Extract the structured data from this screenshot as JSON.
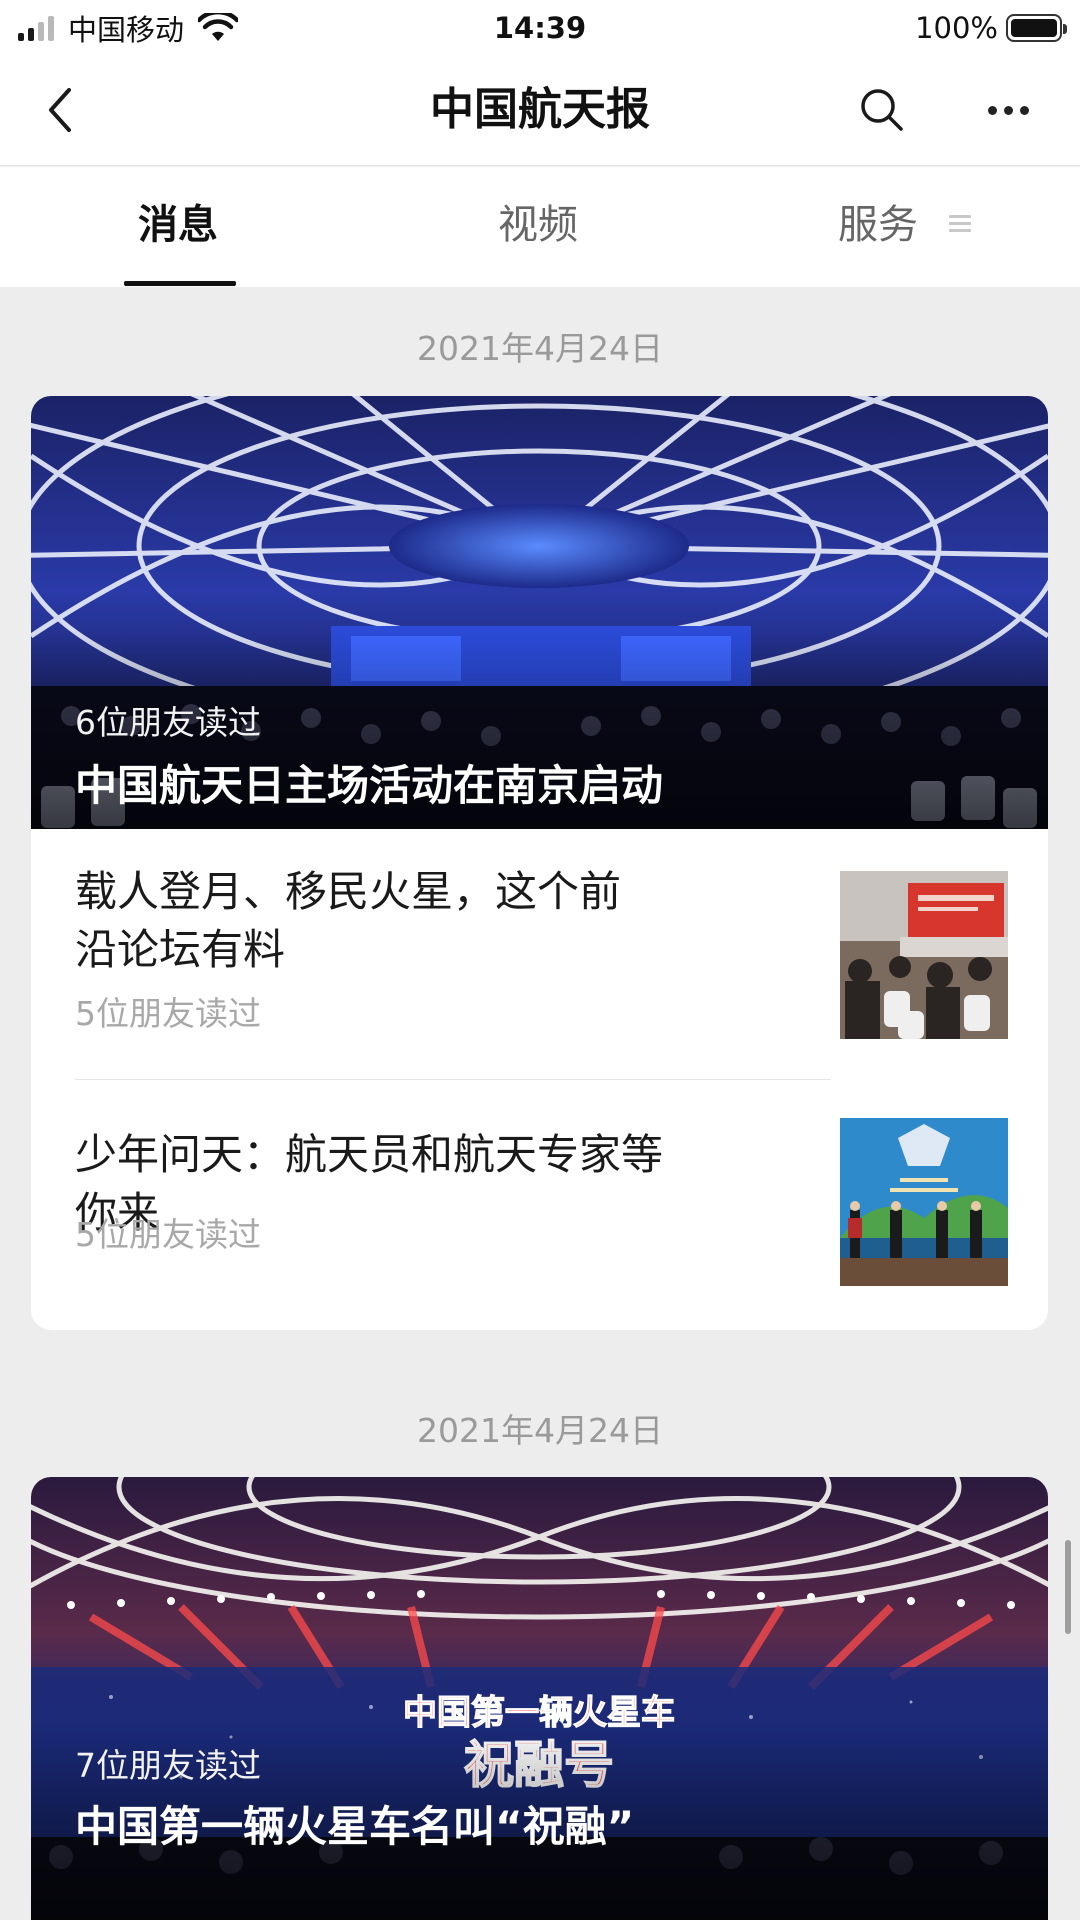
{
  "status_bar": {
    "carrier": "中国移动",
    "time": "14:39",
    "battery_text": "100%",
    "battery_level": 1.0,
    "signal_bars": 2
  },
  "nav": {
    "title": "中国航天报",
    "back_icon": "chevron-left-icon",
    "search_icon": "search-icon",
    "more_icon": "more-dots-icon"
  },
  "tabs": [
    {
      "label": "消息",
      "active": true
    },
    {
      "label": "视频",
      "active": false
    },
    {
      "label": "服务",
      "active": false
    }
  ],
  "feed": [
    {
      "date": "2021年4月24日",
      "cover": {
        "readers": "6位朋友读过",
        "title": "中国航天日主场活动在南京启动"
      },
      "articles": [
        {
          "title": "载人登月、移民火星，这个前沿论坛有料",
          "readers": "5位朋友读过"
        },
        {
          "title": "少年问天：航天员和航天专家等你来",
          "readers": "5位朋友读过"
        }
      ]
    },
    {
      "date": "2021年4月24日",
      "cover": {
        "readers": "7位朋友读过",
        "title": "中国第一辆火星车名叫“祝融”",
        "image_text_line1": "中国第一辆火星车",
        "image_text_line2": "祝融号"
      }
    }
  ],
  "colors": {
    "background": "#ededed",
    "card": "#ffffff",
    "text_primary": "#1a1a1a",
    "text_secondary": "#a8a8a8",
    "tab_indicator": "#111111"
  }
}
